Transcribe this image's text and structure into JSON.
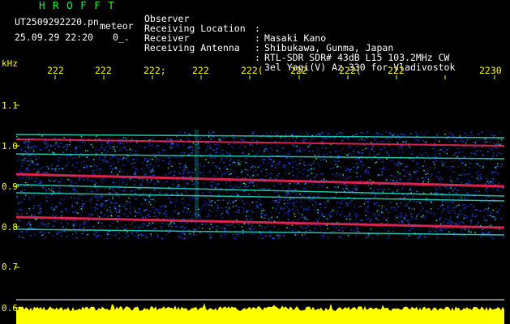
{
  "header": {
    "title": "H R O F F T",
    "filename": "UT2509292220.pn",
    "meteor_label": "meteor",
    "datetime": "25.09.29 22:20",
    "count": "0_.",
    "info": [
      {
        "label": "Observer",
        "value": "Masaki Kano"
      },
      {
        "label": "Receiving Location",
        "value": "Shibukawa, Gunma, Japan"
      },
      {
        "label": "Receiver",
        "value": "RTL-SDR SDR# 43dB L15 103.2MHz CW"
      },
      {
        "label": "Receiving Antenna",
        "value": "3el Yagi(V) Az 330 for Vladivostok"
      }
    ]
  },
  "axis": {
    "unit": "kHz",
    "y_ticks": [
      "1.1",
      "1.0",
      "0.9",
      "0.8",
      "0.7",
      "0.6"
    ],
    "x_ticks": [
      "222",
      "222",
      "222;",
      "222",
      "222(",
      "222",
      "222(",
      "222",
      "2230"
    ]
  },
  "colors": {
    "background": "#000000",
    "label_yellow": "#ffff00",
    "title_green": "#22ee44",
    "noise_blue": "#1a2a8c",
    "echo_red": "#ff2a5a",
    "echo_cyan": "#22e6c8"
  }
}
